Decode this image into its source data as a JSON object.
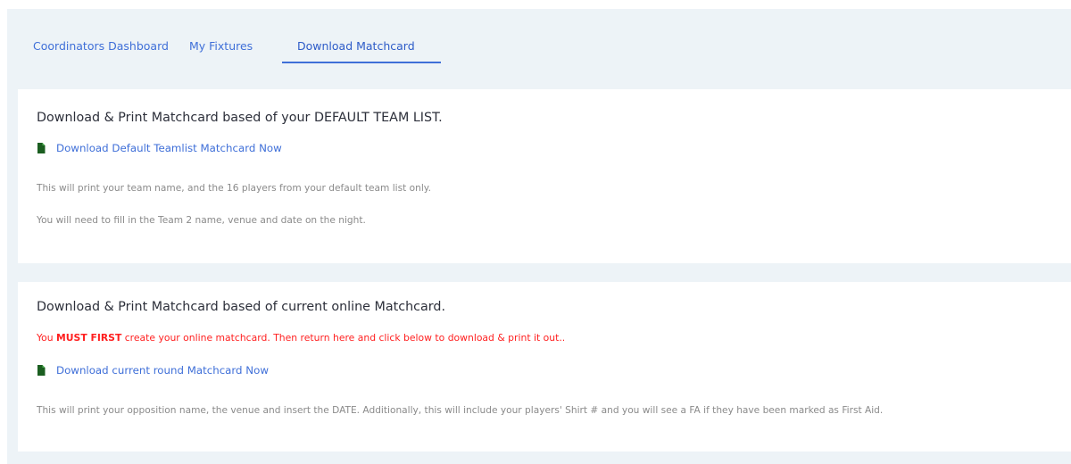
{
  "tabs": [
    {
      "label": "Coordinators Dashboard"
    },
    {
      "label": "My Fixtures"
    },
    {
      "label": "Download Matchcard",
      "active": true
    }
  ],
  "default_team_card": {
    "title": "Download & Print Matchcard based of your DEFAULT TEAM LIST.",
    "link_label": "Download Default Teamlist Matchcard Now",
    "desc_1": "This will print your team name, and the 16 players from your default team list only.",
    "desc_2": "You will need to fill in the Team 2 name, venue and date on the night."
  },
  "online_matchcard_card": {
    "title": "Download & Print Matchcard based of current online Matchcard.",
    "warning_prefix": "You ",
    "warning_bold": "MUST FIRST",
    "warning_suffix": " create your online matchcard. Then return here and click below to download & print it out..",
    "link_label": "Download current round Matchcard Now",
    "desc": "This will print your opposition name, the venue and insert the DATE. Additionally, this will include your players' Shirt # and you will see a FA if they have been marked as First Aid."
  },
  "colors": {
    "accent": "#3f6fd8",
    "warning": "#ff1f1f",
    "icon": "#1b5e20",
    "panel": "#edf3f7"
  },
  "icons": {
    "download_file_icon": "file-icon"
  }
}
